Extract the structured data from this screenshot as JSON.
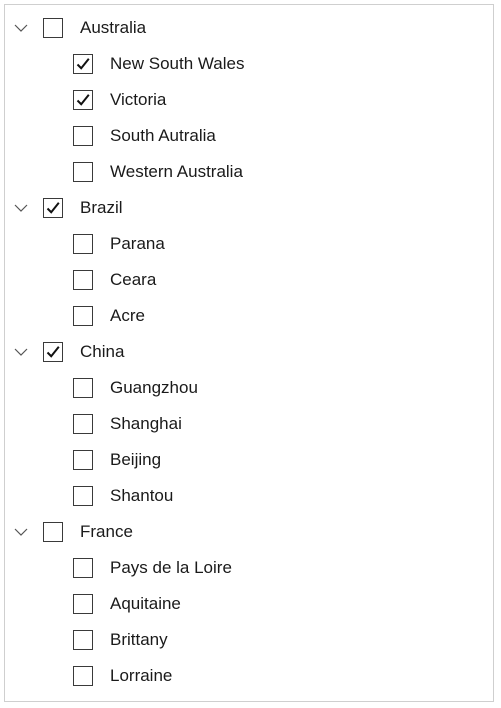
{
  "tree": {
    "nodes": [
      {
        "label": "Australia",
        "checked": false,
        "expanded": true,
        "children": [
          {
            "label": "New South Wales",
            "checked": true
          },
          {
            "label": "Victoria",
            "checked": true
          },
          {
            "label": "South Autralia",
            "checked": false
          },
          {
            "label": "Western Australia",
            "checked": false
          }
        ]
      },
      {
        "label": "Brazil",
        "checked": true,
        "expanded": true,
        "children": [
          {
            "label": "Parana",
            "checked": false
          },
          {
            "label": "Ceara",
            "checked": false
          },
          {
            "label": "Acre",
            "checked": false
          }
        ]
      },
      {
        "label": "China",
        "checked": true,
        "expanded": true,
        "children": [
          {
            "label": "Guangzhou",
            "checked": false
          },
          {
            "label": "Shanghai",
            "checked": false
          },
          {
            "label": "Beijing",
            "checked": false
          },
          {
            "label": "Shantou",
            "checked": false
          }
        ]
      },
      {
        "label": "France",
        "checked": false,
        "expanded": true,
        "children": [
          {
            "label": "Pays de la Loire",
            "checked": false
          },
          {
            "label": "Aquitaine",
            "checked": false
          },
          {
            "label": "Brittany",
            "checked": false
          },
          {
            "label": "Lorraine",
            "checked": false
          }
        ]
      }
    ],
    "icons": {
      "expander": "chevron-down-icon",
      "check": "checkmark-icon"
    },
    "colors": {
      "border": "#cfcfcf",
      "checkbox_border": "#3a3a3a",
      "text": "#1a1a1a"
    }
  }
}
